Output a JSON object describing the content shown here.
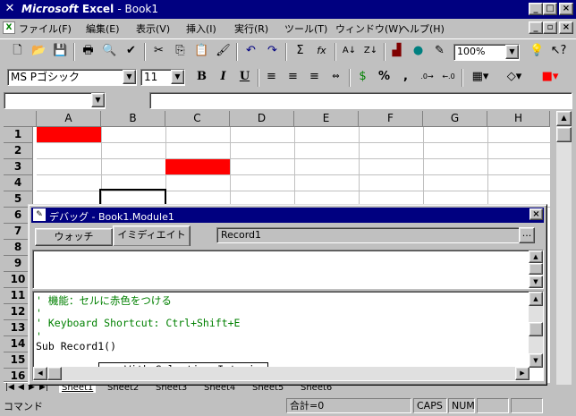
{
  "window": {
    "title_brand": "Microsoft",
    "title_app": "Excel",
    "title_doc": "- Book1",
    "app_icon": "excel-x-icon"
  },
  "menu": [
    "ファイル(F)",
    "編集(E)",
    "表示(V)",
    "挿入(I)",
    "実行(R)",
    "ツール(T)",
    "ウィンドウ(W)",
    "ヘルプ(H)"
  ],
  "toolbar": {
    "zoom_value": "100%",
    "font_name": "MS Pゴシック",
    "font_size": "11",
    "bold_label": "B",
    "italic_label": "I",
    "underline_label": "U",
    "percent_label": "%",
    "comma_label": ","
  },
  "sheet": {
    "columns": [
      "A",
      "B",
      "C",
      "D",
      "E",
      "F",
      "G",
      "H"
    ],
    "rows": [
      "1",
      "2",
      "3",
      "4",
      "5",
      "6",
      "7",
      "8",
      "9",
      "10",
      "11",
      "12",
      "13",
      "14",
      "15",
      "16"
    ],
    "red_fill_color": "#ff0000",
    "tabs": [
      "Sheet1",
      "Sheet2",
      "Sheet3",
      "Sheet4",
      "Sheet5",
      "Sheet6"
    ]
  },
  "debug": {
    "title": "デバッグ - Book1.Module1",
    "tabs": [
      "ウォッチ",
      "イミディエイト"
    ],
    "context": "Record1",
    "context_btn": "...",
    "code_lines": [
      "' 機能：セルに赤色をつける",
      "'",
      "' Keyboard Shortcut: Ctrl+Shift+E",
      "'",
      "Sub Record1()",
      "    With Selection.Interior"
    ]
  },
  "status": {
    "mode": "コマンド",
    "sum": "合計=0",
    "caps": "CAPS",
    "num": "NUM"
  }
}
